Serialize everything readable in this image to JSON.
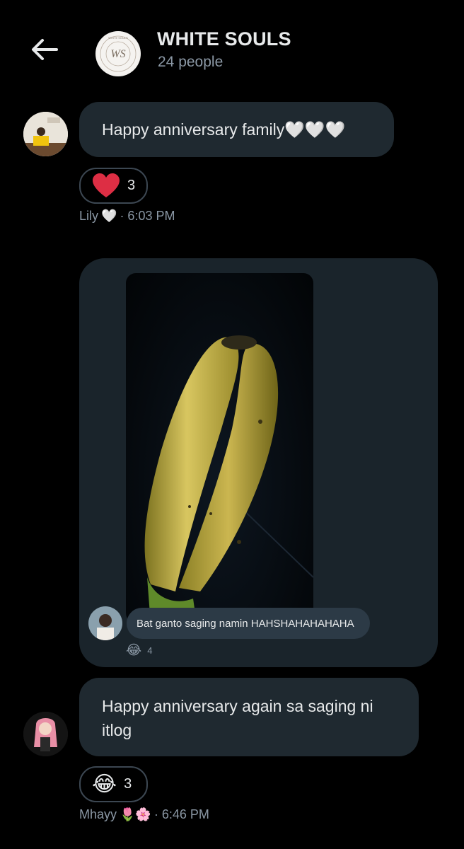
{
  "header": {
    "title": "WHITE SOULS",
    "subtitle": "24 people",
    "avatar_monogram": "WS",
    "avatar_ring_text": "WHITE SOULS"
  },
  "messages": [
    {
      "text": "Happy anniversary family🤍🤍🤍",
      "reaction": {
        "emoji": "heart",
        "count": "3"
      },
      "sender": "Lily",
      "sender_emoji": "🤍",
      "time": "· 6:03 PM"
    },
    {
      "type": "shared-image",
      "photo_subject": "banana",
      "inner_text": "Bat ganto saging namin HAHSHAHAHAHAHA",
      "inner_reaction_emoji": "😂",
      "inner_reaction_count": "4"
    },
    {
      "text": "Happy anniversary again sa saging ni itlog",
      "reaction": {
        "emoji": "😂",
        "count": "3"
      },
      "sender": "Mhayy",
      "sender_emoji": "🌷🌸",
      "time": "· 6:46 PM"
    }
  ],
  "colors": {
    "background": "#000000",
    "bubble": "#1f2930",
    "secondary_text": "#8b98a5",
    "heart": "#e0245e"
  }
}
